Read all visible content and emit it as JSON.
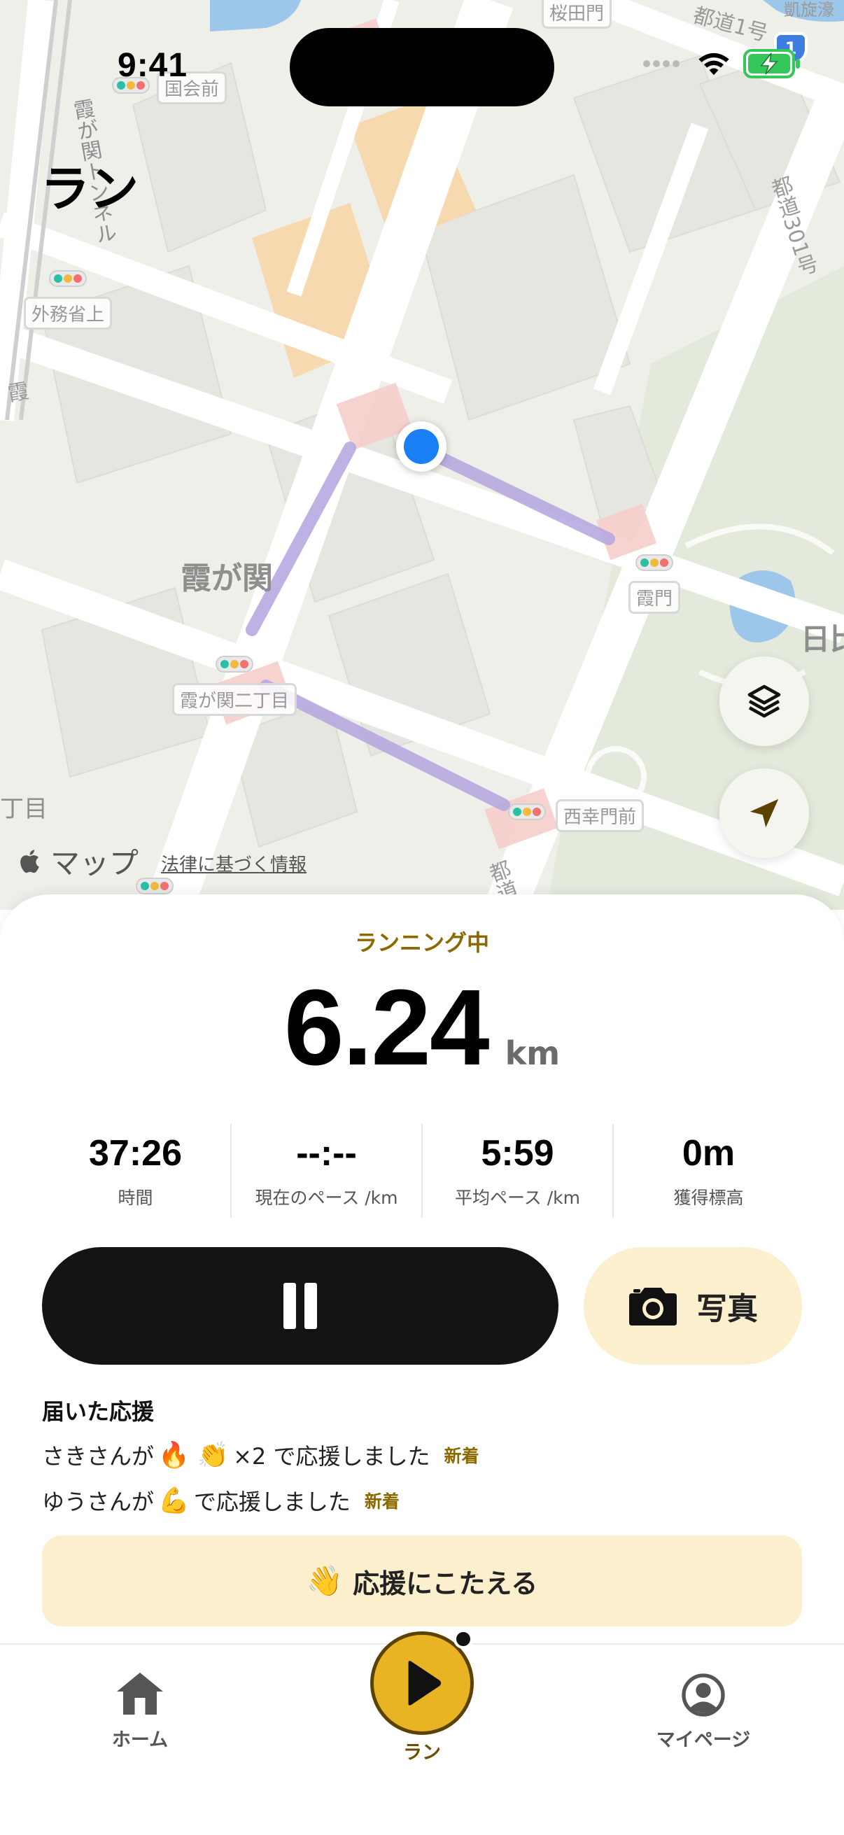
{
  "status_bar": {
    "time": "9:41"
  },
  "header": {
    "title": "ラン"
  },
  "map": {
    "labels": {
      "district": "霞が関",
      "district_partial": "日比",
      "chome_partial": "丁目",
      "expressway": "霞が関トンネル",
      "route_301": "都道301号",
      "route_1": "都道1号",
      "route_1_shield": "1",
      "road_partial": "都道",
      "left_road": "霞",
      "top_right_partial": "凱旋濠"
    },
    "intersections": {
      "kokkaimae": "国会前",
      "sakuradamon": "桜田門",
      "gaimusho_ue": "外務省上",
      "kasumon": "霞門",
      "kasumigaseki_2": "霞が関二丁目",
      "nishi_saiwaimon": "西幸門前"
    },
    "brand": "マップ",
    "legal": "法律に基づく情報"
  },
  "run": {
    "status": "ランニング中",
    "distance": "6.24",
    "distance_unit": "km",
    "stats": [
      {
        "value": "37:26",
        "label": "時間"
      },
      {
        "value": "--:--",
        "label": "現在のペース /km"
      },
      {
        "value": "5:59",
        "label": "平均ペース /km"
      },
      {
        "value": "0m",
        "label": "獲得標高"
      }
    ],
    "photo_label": "写真"
  },
  "cheers": {
    "title": "届いた応援",
    "items": [
      {
        "prefix": "さきさんが",
        "emojis": "🔥 👏",
        "suffix": "×2 で応援しました",
        "badge": "新着"
      },
      {
        "prefix": "ゆうさんが",
        "emojis": "💪",
        "suffix": "で応援しました",
        "badge": "新着"
      }
    ],
    "respond_emoji": "👋",
    "respond_label": "応援にこたえる"
  },
  "tabs": {
    "home": "ホーム",
    "run": "ラン",
    "mypage": "マイページ"
  },
  "colors": {
    "accent": "#e9b424",
    "accent_text": "#8a6a00",
    "soft_yellow": "#fbefcd",
    "location_blue": "#1a7ef5"
  }
}
